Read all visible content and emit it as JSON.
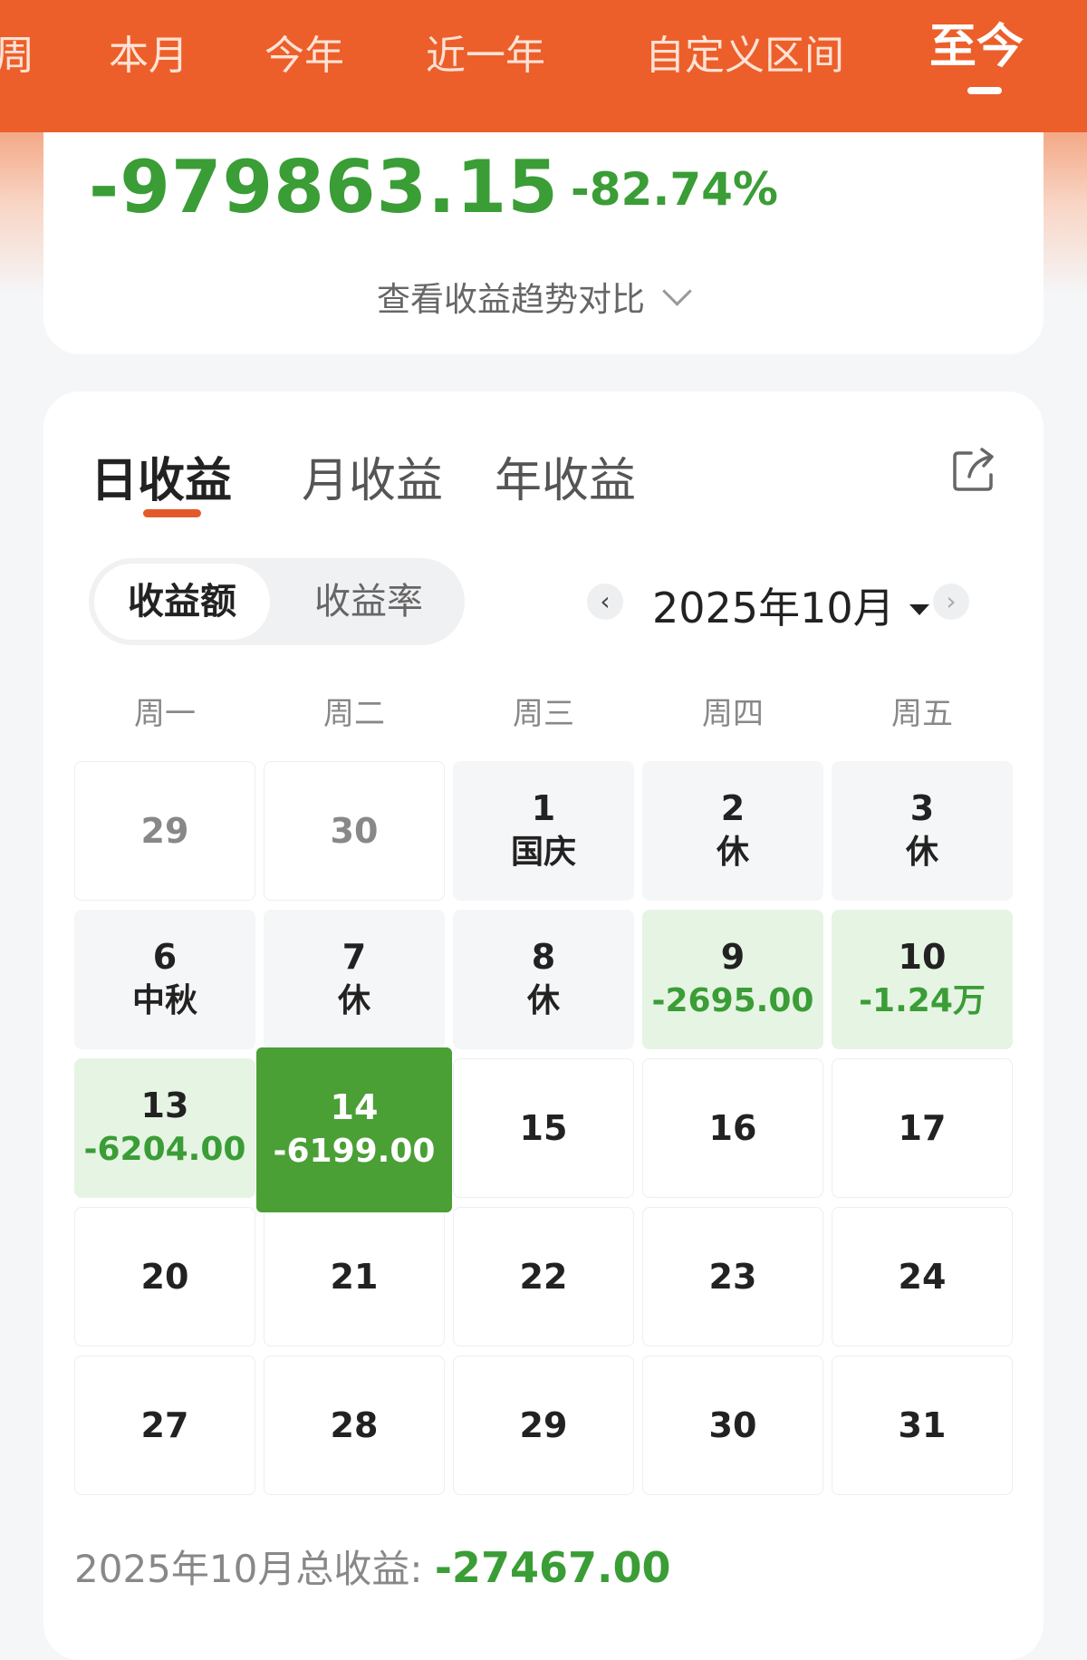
{
  "period_tabs": [
    {
      "label": "周"
    },
    {
      "label": "本月"
    },
    {
      "label": "今年"
    },
    {
      "label": "近一年"
    },
    {
      "label": "自定义区间"
    },
    {
      "label": "至今"
    }
  ],
  "active_period": "至今",
  "summary": {
    "amount": "-979863.15",
    "percent": "-82.74%",
    "trend_link": "查看收益趋势对比"
  },
  "profit_tabs": [
    "日收益",
    "月收益",
    "年收益"
  ],
  "active_profit_tab": "日收益",
  "segment": {
    "on": "收益额",
    "off": "收益率"
  },
  "calendar": {
    "month_label": "2025年10月",
    "prev_icon": "‹",
    "next_icon": "›",
    "weekdays": [
      "周一",
      "周二",
      "周三",
      "周四",
      "周五"
    ],
    "rows": [
      [
        {
          "day": "29",
          "sub": "",
          "state": "prev"
        },
        {
          "day": "30",
          "sub": "",
          "state": "prev"
        },
        {
          "day": "1",
          "sub": "国庆",
          "state": "holiday"
        },
        {
          "day": "2",
          "sub": "休",
          "state": "holiday"
        },
        {
          "day": "3",
          "sub": "休",
          "state": "holiday"
        }
      ],
      [
        {
          "day": "6",
          "sub": "中秋",
          "state": "holiday"
        },
        {
          "day": "7",
          "sub": "休",
          "state": "holiday"
        },
        {
          "day": "8",
          "sub": "休",
          "state": "holiday"
        },
        {
          "day": "9",
          "sub": "-2695.00",
          "state": "loss"
        },
        {
          "day": "10",
          "sub": "-1.24万",
          "state": "loss"
        }
      ],
      [
        {
          "day": "13",
          "sub": "-6204.00",
          "state": "loss"
        },
        {
          "day": "14",
          "sub": "-6199.00",
          "state": "selected"
        },
        {
          "day": "15",
          "sub": "",
          "state": "normal"
        },
        {
          "day": "16",
          "sub": "",
          "state": "normal"
        },
        {
          "day": "17",
          "sub": "",
          "state": "normal"
        }
      ],
      [
        {
          "day": "20",
          "sub": "",
          "state": "normal"
        },
        {
          "day": "21",
          "sub": "",
          "state": "normal"
        },
        {
          "day": "22",
          "sub": "",
          "state": "normal"
        },
        {
          "day": "23",
          "sub": "",
          "state": "normal"
        },
        {
          "day": "24",
          "sub": "",
          "state": "normal"
        }
      ],
      [
        {
          "day": "27",
          "sub": "",
          "state": "normal"
        },
        {
          "day": "28",
          "sub": "",
          "state": "normal"
        },
        {
          "day": "29",
          "sub": "",
          "state": "normal"
        },
        {
          "day": "30",
          "sub": "",
          "state": "normal"
        },
        {
          "day": "31",
          "sub": "",
          "state": "normal"
        }
      ]
    ]
  },
  "total": {
    "label": "2025年10月总收益: ",
    "value": "-27467.00"
  },
  "colors": {
    "brand": "#ec5f2a",
    "loss": "#3a9d36",
    "selected": "#4a9f35"
  },
  "icons": {
    "share": "share-icon",
    "chevron": "chevron-down-icon"
  }
}
